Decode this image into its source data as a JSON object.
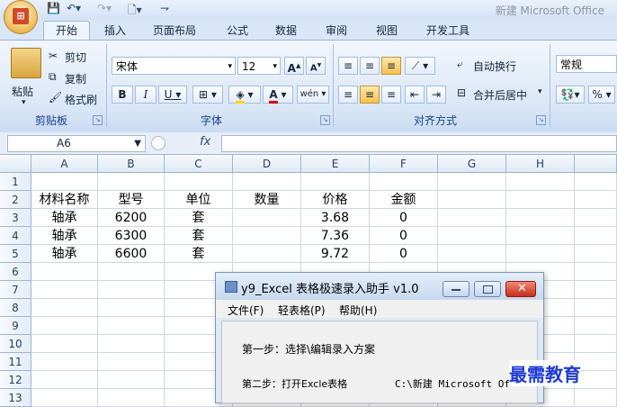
{
  "doc_title": "新建 Microsoft Office",
  "office_logo": "Office",
  "tabs": [
    "开始",
    "插入",
    "页面布局",
    "公式",
    "数据",
    "审阅",
    "视图",
    "开发工具"
  ],
  "clipboard": {
    "paste": "粘贴",
    "cut": "剪切",
    "copy": "复制",
    "format_painter": "格式刷",
    "label": "剪贴板"
  },
  "font": {
    "name": "宋体",
    "size": "12",
    "grow": "A",
    "shrink": "A",
    "bold": "B",
    "italic": "I",
    "underline": "U",
    "font_color_letter": "A",
    "wen": "wén",
    "label": "字体"
  },
  "alignment": {
    "wrap_text": "自动换行",
    "merge_center": "合并后居中",
    "label": "对齐方式"
  },
  "number": {
    "format": "常规",
    "percent": "%",
    "label": ""
  },
  "name_box": "A6",
  "fx_label": "fx",
  "columns": [
    "A",
    "B",
    "C",
    "D",
    "E",
    "F",
    "G",
    "H"
  ],
  "rows": [
    "1",
    "2",
    "3",
    "4",
    "5",
    "6",
    "7",
    "8",
    "9",
    "10",
    "11",
    "12",
    "13"
  ],
  "cells": {
    "r2": [
      "材料名称",
      "型号",
      "单位",
      "数量",
      "价格",
      "金额"
    ],
    "r3": [
      "轴承",
      "6200",
      "套",
      "",
      "3.68",
      "0"
    ],
    "r4": [
      "轴承",
      "6300",
      "套",
      "",
      "7.36",
      "0"
    ],
    "r5": [
      "轴承",
      "6600",
      "套",
      "",
      "9.72",
      "0"
    ]
  },
  "dialog": {
    "title": "y9_Excel 表格极速录入助手 v1.0",
    "menu": [
      "文件(F)",
      "轻表格(P)",
      "帮助(H)"
    ],
    "step1": "第一步：选择\\编辑录入方案",
    "step2": "第二步：打开Excle表格",
    "step2_path": "C:\\新建 Microsoft Of"
  },
  "watermark": "最需教育",
  "colors": {
    "accent": "#15428b",
    "close_button": "#d9432e",
    "watermark": "#1d3bd6"
  }
}
